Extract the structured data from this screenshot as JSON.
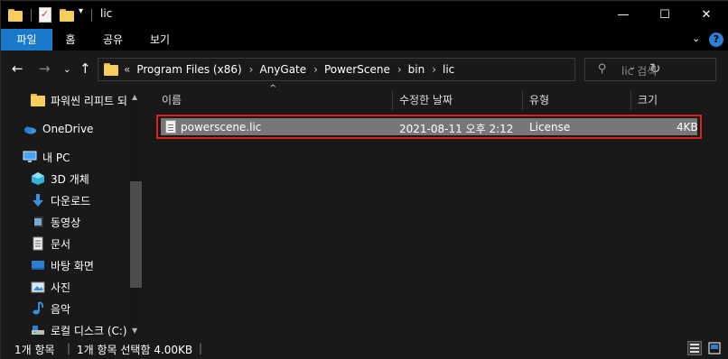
{
  "window": {
    "title": "lic",
    "controls": {
      "minimize": "—",
      "maximize": "☐",
      "close": "✕"
    }
  },
  "ribbon": {
    "tabs": [
      {
        "label": "파일",
        "active": true
      },
      {
        "label": "홈"
      },
      {
        "label": "공유"
      },
      {
        "label": "보기"
      }
    ],
    "help_label": "?"
  },
  "address": {
    "overflow": "«",
    "crumbs": [
      "Program Files (x86)",
      "AnyGate",
      "PowerScene",
      "bin",
      "lic"
    ],
    "separator": "›"
  },
  "search": {
    "placeholder": "lic 검색"
  },
  "nav_pane": {
    "items": [
      {
        "label": "파워씬 리피트 되",
        "icon": "folder-icon"
      },
      {
        "label": "OneDrive",
        "icon": "onedrive-icon"
      },
      {
        "label": "내 PC",
        "icon": "pc-icon"
      },
      {
        "label": "3D 개체",
        "icon": "3d-objects-icon"
      },
      {
        "label": "다운로드",
        "icon": "download-icon"
      },
      {
        "label": "동영상",
        "icon": "video-icon"
      },
      {
        "label": "문서",
        "icon": "document-icon"
      },
      {
        "label": "바탕 화면",
        "icon": "desktop-icon"
      },
      {
        "label": "사진",
        "icon": "pictures-icon"
      },
      {
        "label": "음악",
        "icon": "music-icon"
      },
      {
        "label": "로컬 디스크 (C:)",
        "icon": "drive-icon"
      }
    ]
  },
  "columns": {
    "name": "이름",
    "modified": "수정한 날짜",
    "type": "유형",
    "size": "크기"
  },
  "files": [
    {
      "name": "powerscene.lic",
      "modified": "2021-08-11 오후 2:12",
      "type": "License",
      "size": "4KB",
      "selected": true
    }
  ],
  "status": {
    "item_count": "1개 항목",
    "selection": "1개 항목 선택함 4.00KB"
  },
  "colors": {
    "selection_outline": "#e02020",
    "accent": "#1979ca",
    "folder": "#f7ce5b"
  }
}
